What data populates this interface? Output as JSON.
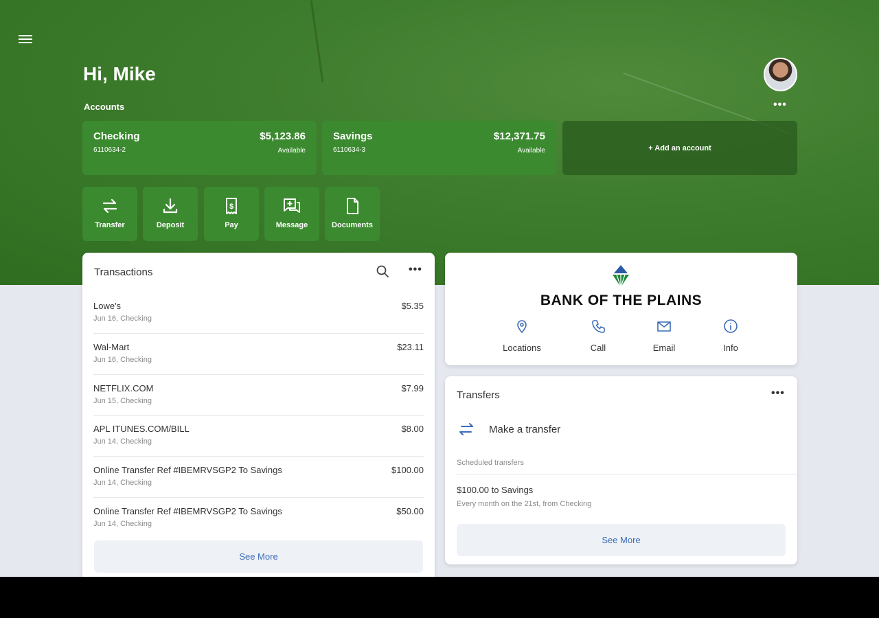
{
  "colors": {
    "brand_green": "#3b8a2f",
    "link_blue": "#3b6cb8",
    "page_bg": "#e5e8ee"
  },
  "header": {
    "greeting": "Hi, Mike",
    "accounts_label": "Accounts",
    "menu_icon": "hamburger-icon",
    "more_icon": "more-dots-icon"
  },
  "accounts": [
    {
      "name": "Checking",
      "number": "6110634-2",
      "balance": "$5,123.86",
      "status": "Available"
    },
    {
      "name": "Savings",
      "number": "6110634-3",
      "balance": "$12,371.75",
      "status": "Available"
    }
  ],
  "add_account": "+ Add an account",
  "actions": [
    {
      "label": "Transfer",
      "icon": "transfer-icon"
    },
    {
      "label": "Deposit",
      "icon": "deposit-icon"
    },
    {
      "label": "Pay",
      "icon": "pay-icon"
    },
    {
      "label": "Message",
      "icon": "message-icon"
    },
    {
      "label": "Documents",
      "icon": "documents-icon"
    }
  ],
  "transactions": {
    "title": "Transactions",
    "items": [
      {
        "desc": "Lowe's",
        "meta": "Jun 16, Checking",
        "amount": "$5.35"
      },
      {
        "desc": "Wal-Mart",
        "meta": "Jun 16, Checking",
        "amount": "$23.11"
      },
      {
        "desc": "NETFLIX.COM",
        "meta": "Jun 15, Checking",
        "amount": "$7.99"
      },
      {
        "desc": "APL ITUNES.COM/BILL",
        "meta": "Jun 14, Checking",
        "amount": "$8.00"
      },
      {
        "desc": "Online Transfer Ref #IBEMRVSGP2 To Savings",
        "meta": "Jun 14, Checking",
        "amount": "$100.00"
      },
      {
        "desc": "Online Transfer Ref #IBEMRVSGP2 To Savings",
        "meta": "Jun 14, Checking",
        "amount": "$50.00"
      }
    ],
    "see_more": "See More"
  },
  "bank": {
    "name": "BANK OF THE PLAINS",
    "contacts": [
      {
        "label": "Locations",
        "icon": "location-pin-icon"
      },
      {
        "label": "Call",
        "icon": "phone-icon"
      },
      {
        "label": "Email",
        "icon": "email-icon"
      },
      {
        "label": "Info",
        "icon": "info-icon"
      }
    ]
  },
  "transfers": {
    "title": "Transfers",
    "make_transfer": "Make a transfer",
    "scheduled_label": "Scheduled transfers",
    "scheduled_item_title": "$100.00 to Savings",
    "scheduled_item_sub": "Every month on the 21st, from Checking",
    "see_more": "See More"
  }
}
